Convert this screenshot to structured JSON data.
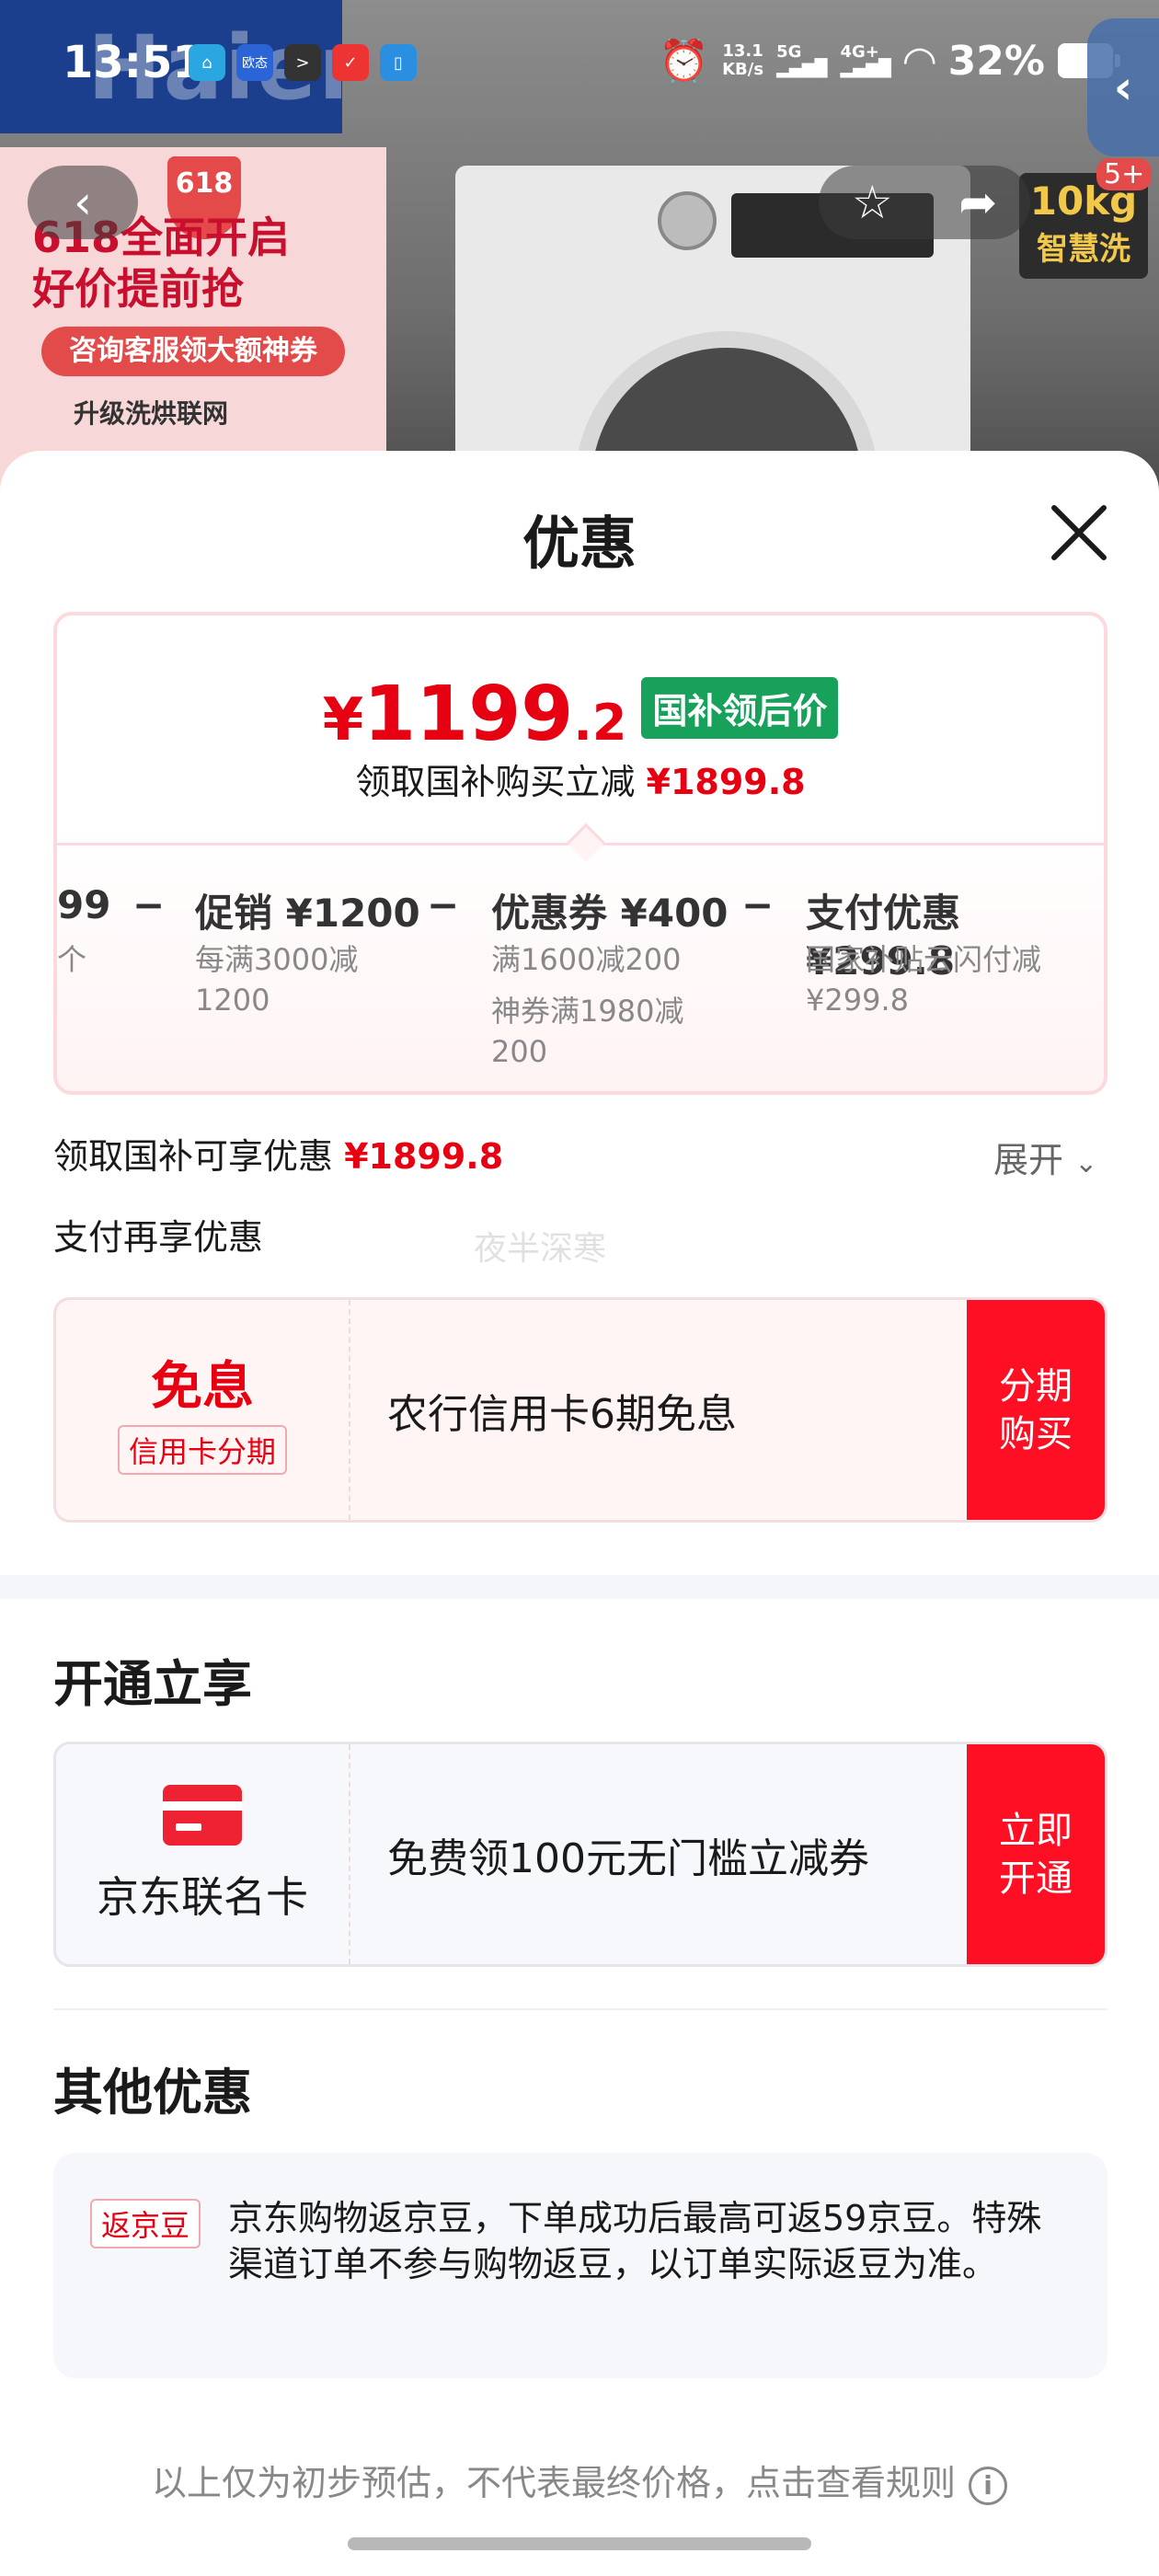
{
  "status_bar": {
    "time": "13:51",
    "app_icons": [
      "home-app-icon",
      "欧态",
      "terminal-app-icon",
      "mail-app-icon",
      "phone-app-icon"
    ],
    "speed_value": "13.1",
    "speed_unit": "KB/s",
    "net_5g": "5G",
    "net_4g": "4G+",
    "battery": "32%"
  },
  "background": {
    "brand_logo": "Haier",
    "poster_618": "618",
    "poster_title_1": "618全面开启",
    "poster_title_2": "好价提前抢",
    "poster_button": "咨询客服领大额神券",
    "poster_line": "升级洗烘联网",
    "badge_capacity": "10kg",
    "badge_name": "智慧洗",
    "badge_plus": "5+"
  },
  "sheet": {
    "title": "优惠"
  },
  "price_card": {
    "yen": "¥",
    "price_int": "1199",
    "price_dec": ".2",
    "tag": "国补领后价",
    "sub_label": "领取国补购买立减",
    "sub_value": "¥1899.8",
    "calc": {
      "truncated_value": "99",
      "truncated_sub": "个",
      "items": [
        {
          "title": "促销 ¥1200",
          "lines": [
            "每满3000减",
            "1200"
          ]
        },
        {
          "title": "优惠券 ¥400",
          "lines": [
            "满1600减200",
            "神券满1980减",
            "200"
          ]
        },
        {
          "title": "支付优惠 ¥299.8",
          "lines": [
            "国家补贴云闪付减",
            "¥299.8"
          ]
        }
      ],
      "minus": "−"
    }
  },
  "gov_subsidy": {
    "label": "领取国补可享优惠",
    "value": "¥1899.8",
    "expand": "展开"
  },
  "pay_section": {
    "label": "支付再享优惠",
    "watermark": "夜半深寒",
    "card": {
      "title": "免息",
      "tag": "信用卡分期",
      "text": "农行信用卡6期免息",
      "button_line1": "分期",
      "button_line2": "购买"
    }
  },
  "open_section": {
    "title": "开通立享",
    "card": {
      "name": "京东联名卡",
      "text": "免费领100元无门槛立减券",
      "button_line1": "立即",
      "button_line2": "开通"
    }
  },
  "other_section": {
    "title": "其他优惠",
    "tag": "返京豆",
    "text": "京东购物返京豆，下单成功后最高可返59京豆。特殊渠道订单不参与购物返豆，以订单实际返豆为准。"
  },
  "footer": {
    "note": "以上仅为初步预估，不代表最终价格，点击查看规则",
    "info_icon": "i"
  },
  "colors": {
    "accent_red": "#e60012",
    "button_red": "#ff0f23",
    "green_tag": "#17a15a"
  }
}
